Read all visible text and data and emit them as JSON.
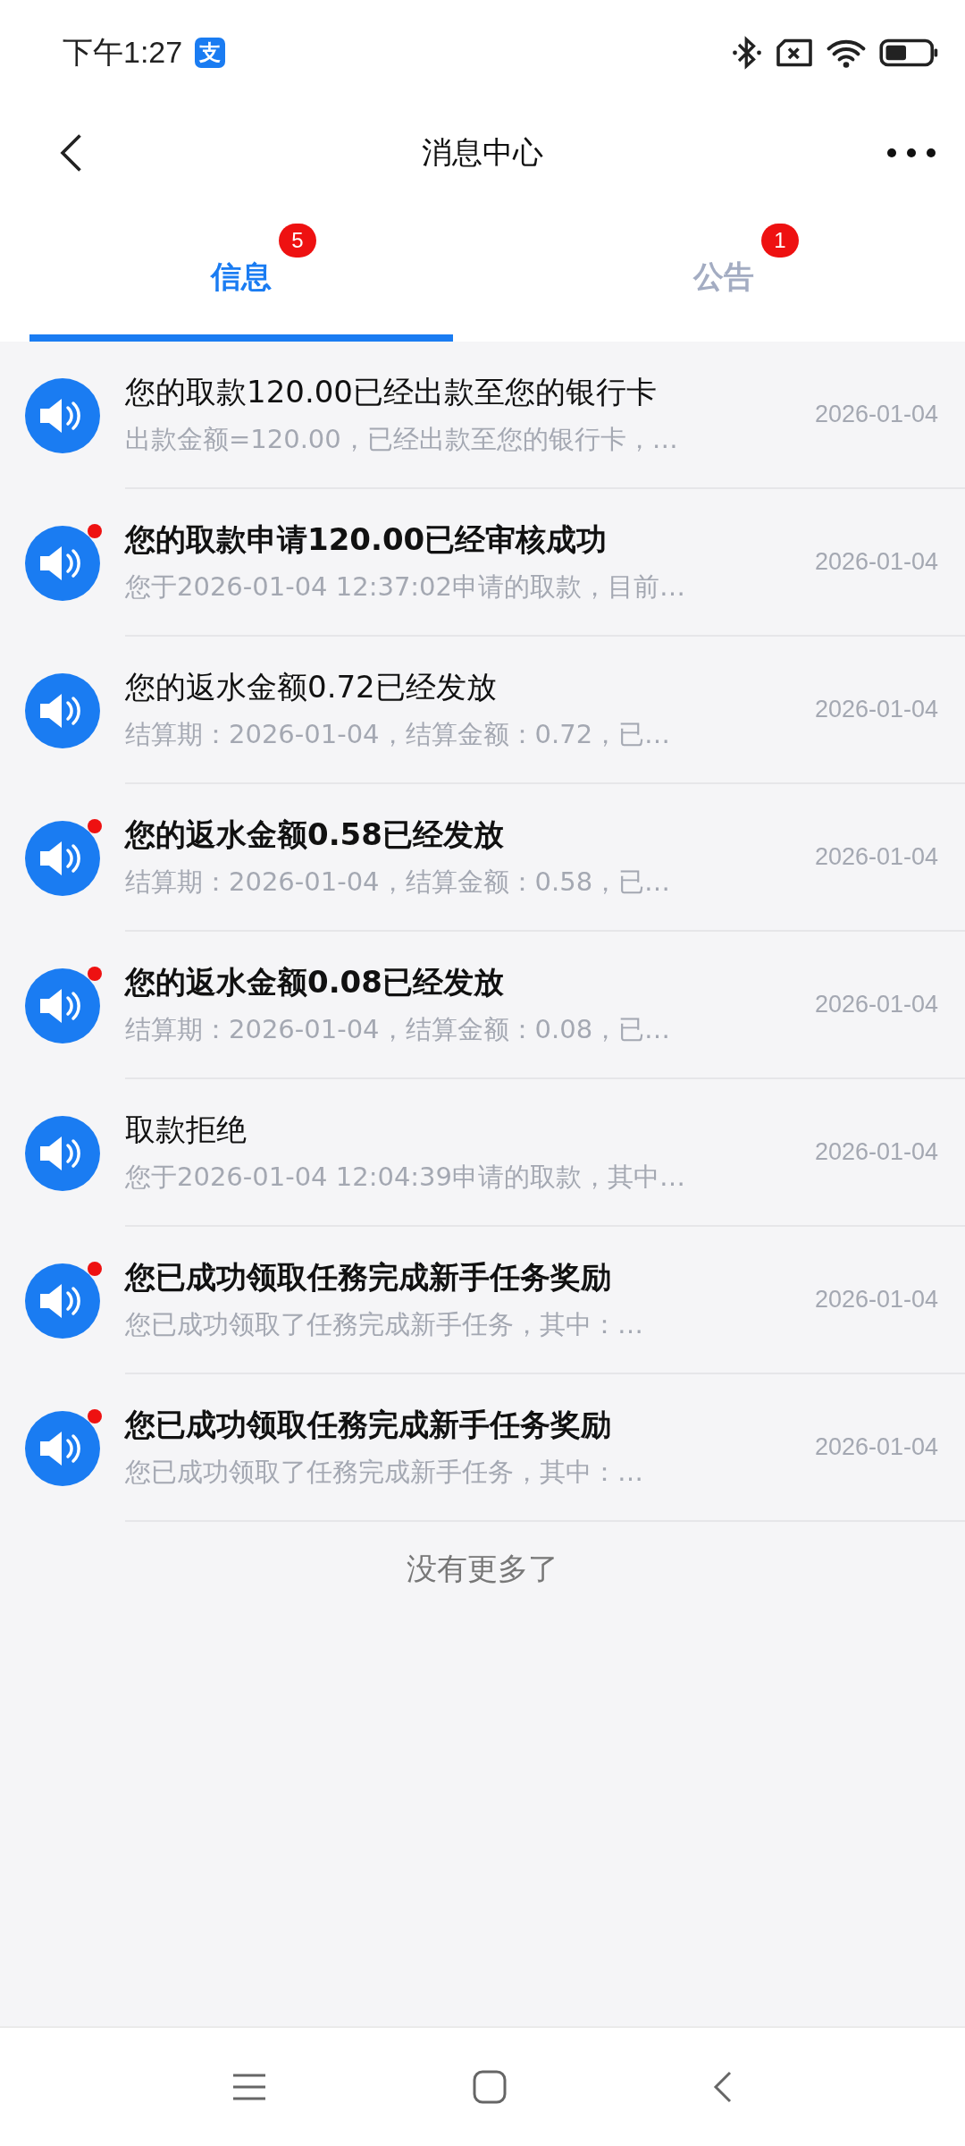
{
  "status_bar": {
    "time": "下午1:27",
    "app_badge": "支"
  },
  "header": {
    "title": "消息中心"
  },
  "tabs": [
    {
      "label": "信息",
      "selected": true,
      "badge": "5"
    },
    {
      "label": "公告",
      "selected": false,
      "badge": "1"
    }
  ],
  "messages": [
    {
      "title": "您的取款120.00已经出款至您的银行卡",
      "preview": "出款金额=120.00，已经出款至您的银行卡，…",
      "date": "2026-01-04",
      "unread": false
    },
    {
      "title": "您的取款申请120.00已经审核成功",
      "preview": "您于2026-01-04 12:37:02申请的取款，目前…",
      "date": "2026-01-04",
      "unread": true
    },
    {
      "title": "您的返水金额0.72已经发放",
      "preview": "结算期：2026-01-04，结算金额：0.72，已…",
      "date": "2026-01-04",
      "unread": false
    },
    {
      "title": "您的返水金额0.58已经发放",
      "preview": "结算期：2026-01-04，结算金额：0.58，已…",
      "date": "2026-01-04",
      "unread": true
    },
    {
      "title": "您的返水金额0.08已经发放",
      "preview": "结算期：2026-01-04，结算金额：0.08，已…",
      "date": "2026-01-04",
      "unread": true
    },
    {
      "title": "取款拒绝",
      "preview": "您于2026-01-04 12:04:39申请的取款，其中…",
      "date": "2026-01-04",
      "unread": false
    },
    {
      "title": "您已成功领取任務完成新手任务奖励",
      "preview": "您已成功领取了任務完成新手任务，其中：…",
      "date": "2026-01-04",
      "unread": true
    },
    {
      "title": "您已成功领取任務完成新手任务奖励",
      "preview": "您已成功领取了任務完成新手任务，其中：…",
      "date": "2026-01-04",
      "unread": true
    }
  ],
  "end_text": "没有更多了"
}
